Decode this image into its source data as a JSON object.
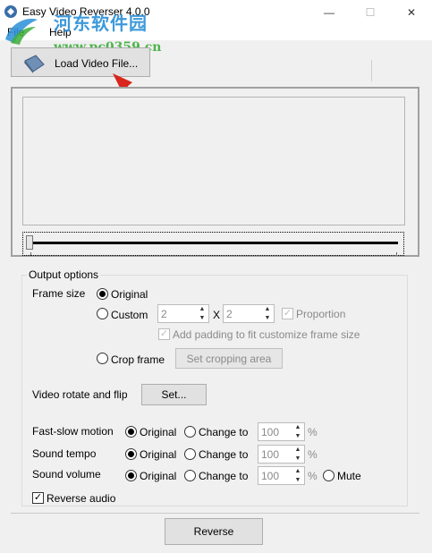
{
  "window": {
    "title": "Easy Video Reverser 4.0.0",
    "minimize_glyph": "—",
    "maximize_glyph": "☐",
    "close_glyph": "✕"
  },
  "watermark": {
    "main": "河东软件园",
    "url": "www.pc0359.cn"
  },
  "menu": {
    "file": "File",
    "help": "Help"
  },
  "toolbar": {
    "load_video": "Load Video File..."
  },
  "output_options": {
    "legend": "Output options",
    "frame_size": {
      "label": "Frame size",
      "original": "Original",
      "custom": "Custom",
      "width": "2",
      "x_sep": "X",
      "height": "2",
      "proportion": "Proportion",
      "padding": "Add padding to fit customize frame size",
      "crop": "Crop frame",
      "set_crop": "Set cropping area"
    },
    "rotate": {
      "label": "Video rotate and flip",
      "set": "Set..."
    },
    "fast_slow": {
      "label": "Fast-slow motion",
      "original": "Original",
      "change": "Change to",
      "value": "100",
      "unit": "%"
    },
    "sound_tempo": {
      "label": "Sound tempo",
      "original": "Original",
      "change": "Change to",
      "value": "100",
      "unit": "%"
    },
    "sound_volume": {
      "label": "Sound volume",
      "original": "Original",
      "change": "Change to",
      "value": "100",
      "unit": "%",
      "mute": "Mute"
    },
    "reverse_audio": "Reverse audio",
    "reverse_audio_checked": true
  },
  "actions": {
    "reverse": "Reverse"
  },
  "colors": {
    "arrow": "#d9261c",
    "watermark_blue": "#2a8fd6",
    "watermark_green": "#3cae3a"
  }
}
